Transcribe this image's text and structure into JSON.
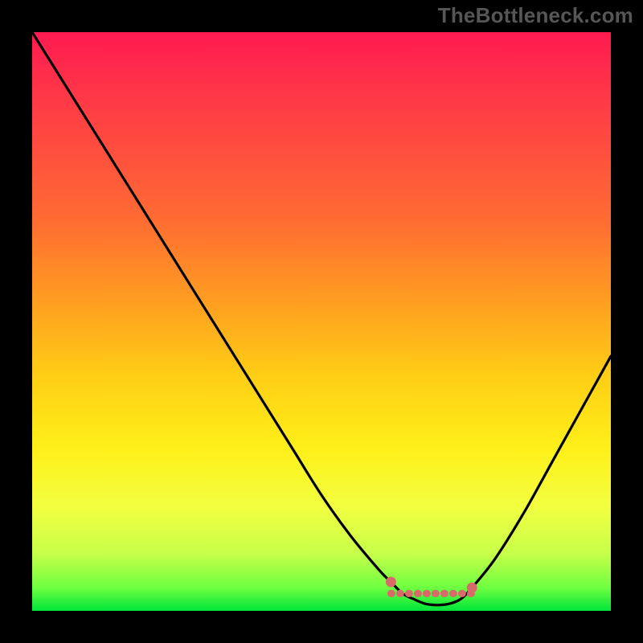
{
  "watermark": "TheBottleneck.com",
  "colors": {
    "background": "#000000",
    "curve": "#000000",
    "marker": "#d96a6a",
    "gradient_top": "#ff1a50",
    "gradient_bottom": "#00e53a"
  },
  "chart_data": {
    "type": "line",
    "title": "",
    "xlabel": "",
    "ylabel": "",
    "xlim": [
      0,
      100
    ],
    "ylim": [
      0,
      100
    ],
    "x": [
      0,
      5,
      10,
      15,
      20,
      25,
      30,
      35,
      40,
      45,
      50,
      55,
      60,
      62,
      64,
      66,
      68,
      70,
      72,
      74,
      76,
      80,
      85,
      90,
      95,
      100
    ],
    "y": [
      100,
      92,
      84,
      76,
      68,
      60,
      52,
      44,
      36,
      28,
      20,
      13,
      7,
      5,
      3,
      2,
      1.2,
      1,
      1.2,
      2,
      4,
      9,
      17,
      26,
      35,
      44
    ],
    "flat_region_x": [
      62,
      76
    ],
    "markers": [
      {
        "x": 62,
        "y": 5
      },
      {
        "x": 76,
        "y": 4
      }
    ]
  }
}
